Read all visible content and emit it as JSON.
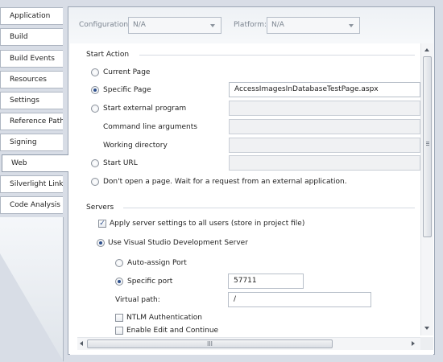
{
  "sidebar": {
    "tabs": [
      {
        "label": "Application"
      },
      {
        "label": "Build"
      },
      {
        "label": "Build Events"
      },
      {
        "label": "Resources"
      },
      {
        "label": "Settings"
      },
      {
        "label": "Reference Paths"
      },
      {
        "label": "Signing"
      },
      {
        "label": "Web",
        "selected": true
      },
      {
        "label": "Silverlight Links"
      },
      {
        "label": "Code Analysis"
      }
    ]
  },
  "toolbar": {
    "configuration_label": "Configuration:",
    "configuration_value": "N/A",
    "platform_label": "Platform:",
    "platform_value": "N/A"
  },
  "start_action": {
    "header": "Start Action",
    "current_page": "Current Page",
    "specific_page": "Specific Page",
    "specific_page_value": "AccessImagesInDatabaseTestPage.aspx",
    "external_program": "Start external program",
    "command_line_args": "Command line arguments",
    "working_directory": "Working directory",
    "start_url": "Start URL",
    "dont_open": "Don't open a page.  Wait for a request from an external application."
  },
  "servers": {
    "header": "Servers",
    "apply_all": "Apply server settings to all users (store in project file)",
    "use_vs_dev": "Use Visual Studio Development Server",
    "auto_assign": "Auto-assign Port",
    "specific_port": "Specific port",
    "specific_port_value": "57711",
    "virtual_path": "Virtual path:",
    "virtual_path_value": "/",
    "ntlm": "NTLM Authentication",
    "edit_continue": "Enable Edit and Continue"
  },
  "scrollbar": {
    "grip": "III"
  },
  "colors": {
    "selected_radio": "#2d4f8c",
    "panel_border": "#9ba5b4"
  }
}
